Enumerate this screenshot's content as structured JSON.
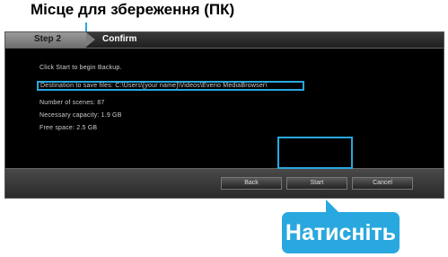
{
  "annotation": {
    "heading": "Місце для збереження (ПК)",
    "callout": "Натисніть",
    "accent_color": "#29a8df"
  },
  "dialog": {
    "step_label": "Step 2",
    "title": "Confirm",
    "lines": [
      "Click Start to begin Backup.",
      "Destination to save files: C:\\Users\\[your name]\\Videos\\Everio MediaBrowser\\",
      "Number of scenes: 87",
      "Necessary capacity: 1.9 GB",
      "Free space: 2.5 GB"
    ],
    "buttons": {
      "back": "Back",
      "start": "Start",
      "cancel": "Cancel"
    }
  }
}
